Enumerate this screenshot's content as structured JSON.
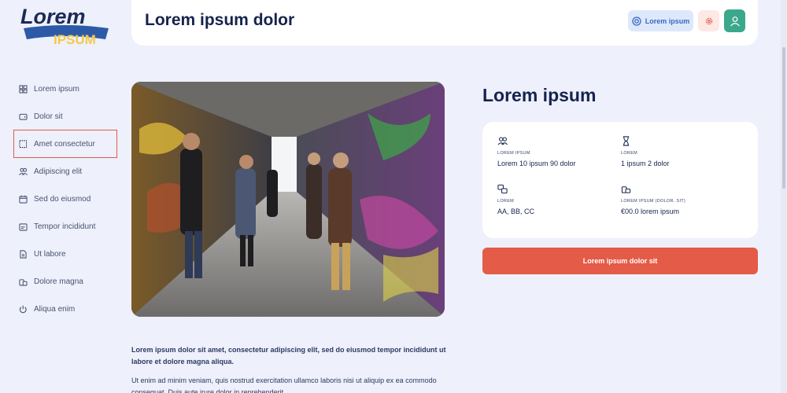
{
  "app": {
    "logo_word": "Lorem",
    "logo_sub": "IPSUM"
  },
  "header": {
    "title": "Lorem ipsum dolor",
    "help_label": "Lorem ipsum"
  },
  "sidebar": {
    "items": [
      {
        "label": "Lorem ipsum",
        "icon": "dashboard-icon",
        "active": false
      },
      {
        "label": "Dolor sit",
        "icon": "wallet-icon",
        "active": false
      },
      {
        "label": "Amet consectetur",
        "icon": "selection-icon",
        "active": true
      },
      {
        "label": "Adipiscing elit",
        "icon": "users-icon",
        "active": false
      },
      {
        "label": "Sed do eiusmod",
        "icon": "calendar-icon",
        "active": false
      },
      {
        "label": "Tempor incididunt",
        "icon": "history-icon",
        "active": false
      },
      {
        "label": "Ut labore",
        "icon": "document-icon",
        "active": false
      },
      {
        "label": "Dolore magna",
        "icon": "credits-icon",
        "active": false
      },
      {
        "label": "Aliqua enim",
        "icon": "power-icon",
        "active": false
      }
    ]
  },
  "activity": {
    "title": "Lorem ipsum",
    "photo_alt": "Lorem ipsum dolor sit amet",
    "info": {
      "participants_label": "LOREM IPSUM",
      "participants_value": "Lorem 10 ipsum 90 dolor",
      "duration_label": "LOREM",
      "duration_value": "1 ipsum 2 dolor",
      "languages_label": "LOREM",
      "languages_value": "AA, BB, CC",
      "budget_label": "LOREM IPSUM (DOLOR. SIT)",
      "budget_value": "€00.0 lorem ipsum"
    },
    "exclude_label": "Lorem ipsum dolor sit",
    "description_bold": "Lorem ipsum dolor sit amet, consectetur adipiscing elit, sed do eiusmod tempor incididunt ut labore et dolore magna aliqua.",
    "description_rest": "Ut enim ad minim veniam, quis nostrud exercitation ullamco laboris nisi ut aliquip ex ea commodo consequat. Duis aute irure dolor in reprehenderit."
  },
  "colors": {
    "accent": "#e45b47",
    "background": "#eef0fb",
    "navy": "#16234d",
    "teal": "#3ba88c"
  }
}
